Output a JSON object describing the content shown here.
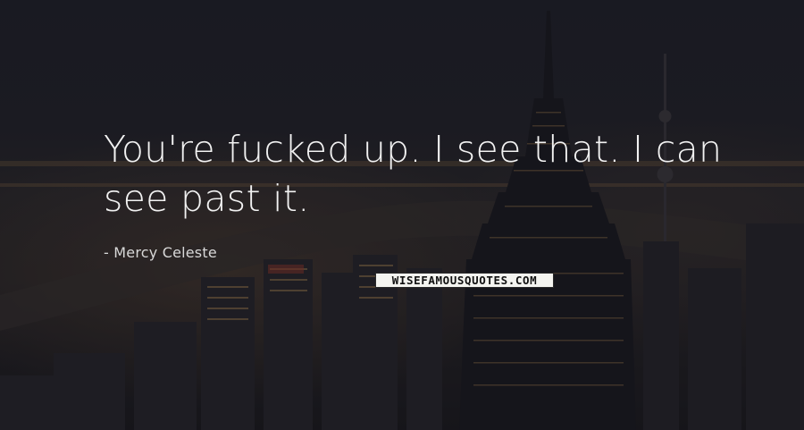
{
  "quote": {
    "text": "You're fucked up. I see that. I can see past it.",
    "author_prefix": "-",
    "author": "Mercy Celeste"
  },
  "watermark": {
    "text": "WISEFAMOUSQUOTES.COM"
  },
  "colors": {
    "text": "#f2f2f2",
    "background": "#1b1c23"
  }
}
